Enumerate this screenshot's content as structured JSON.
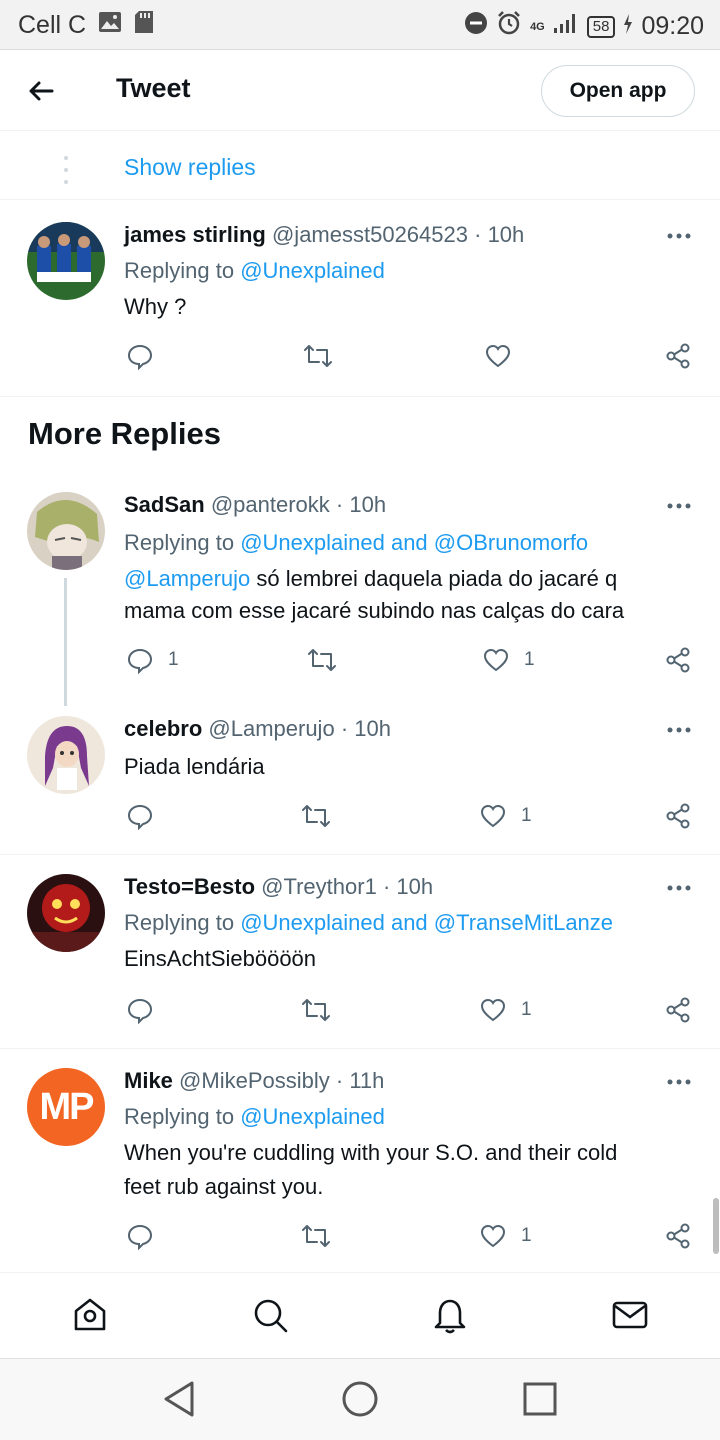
{
  "status_bar": {
    "carrier": "Cell C",
    "network": "4G",
    "battery": "58",
    "time": "09:20"
  },
  "header": {
    "title": "Tweet",
    "open_app": "Open app"
  },
  "show_replies": "Show replies",
  "more_replies_heading": "More Replies",
  "tweets": [
    {
      "name": "james stirling",
      "handle": "@jamesst50264523",
      "time": "10h",
      "replying_prefix": "Replying to",
      "replying_to": "@Unexplained",
      "text_lines": [
        "Why ?"
      ],
      "reply_count": "",
      "like_count": ""
    },
    {
      "name": "SadSan",
      "handle": "@panterokk",
      "time": "10h",
      "replying_prefix": "Replying to",
      "replying_to": "@Unexplained and @OBrunomorfo",
      "mention": "@Lamperujo",
      "text_lines": [
        " só lembrei daquela piada do jacaré q",
        "mama com esse jacaré subindo nas calças do cara"
      ],
      "reply_count": "1",
      "like_count": "1"
    },
    {
      "name": "celebro",
      "handle": "@Lamperujo",
      "time": "10h",
      "text_lines": [
        "Piada lendária"
      ],
      "reply_count": "",
      "like_count": "1"
    },
    {
      "name": "Testo=Besto",
      "handle": "@Treythor1",
      "time": "10h",
      "replying_prefix": "Replying to",
      "replying_to": "@Unexplained and @TranseMitLanze",
      "text_lines": [
        "EinsAchtSieböööön"
      ],
      "reply_count": "",
      "like_count": "1"
    },
    {
      "name": "Mike",
      "handle": "@MikePossibly",
      "time": "11h",
      "replying_prefix": "Replying to",
      "replying_to": "@Unexplained",
      "text_lines": [
        "When you're cuddling with your S.O. and their cold",
        "feet rub against you."
      ],
      "reply_count": "",
      "like_count": "1",
      "avatar_initials": "MP"
    }
  ],
  "colors": {
    "link": "#1d9bf0",
    "secondary_text": "#536471",
    "primary_text": "#0f1419",
    "mp_avatar": "#f26522"
  },
  "icons": {
    "back": "arrow-left-icon",
    "reply": "reply-icon",
    "retweet": "retweet-icon",
    "like": "heart-icon",
    "share": "share-icon",
    "more": "more-horizontal-icon",
    "home": "home-icon",
    "search": "search-icon",
    "notifications": "bell-icon",
    "messages": "mail-icon"
  }
}
